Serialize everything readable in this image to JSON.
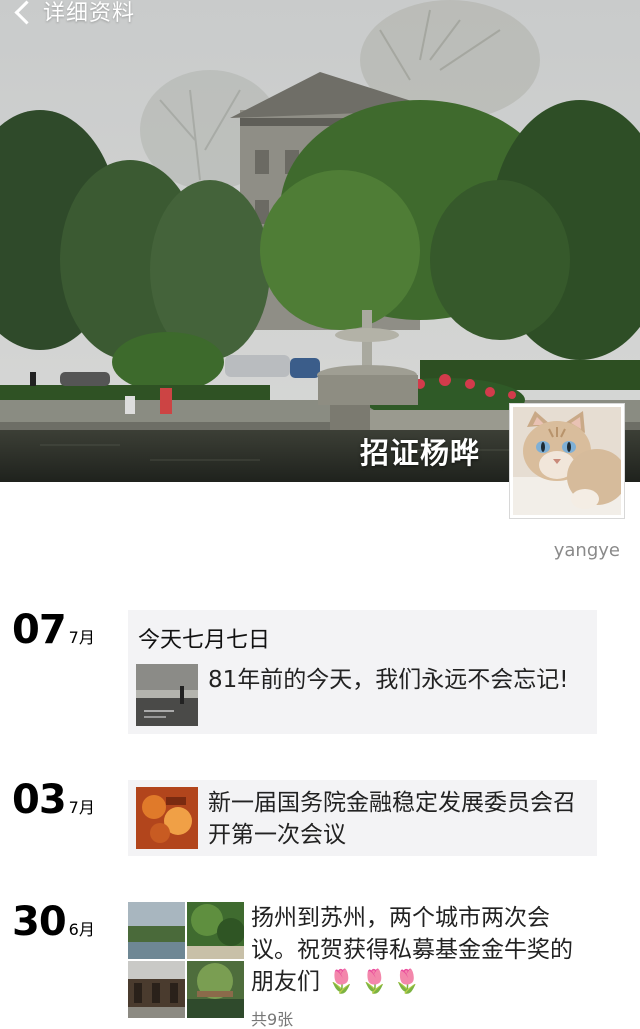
{
  "nav": {
    "back_label": "详细资料",
    "back_icon": "chevron-left-icon"
  },
  "profile": {
    "name": "招证杨晔",
    "signature": "yangye",
    "avatar_subject": "cat"
  },
  "timeline": [
    {
      "day": "07",
      "month": "7月",
      "title": "今天七月七日",
      "link_text": "81年前的今天，我们永远不会忘记!"
    },
    {
      "day": "03",
      "month": "7月",
      "link_text": "新一届国务院金融稳定发展委员会召开第一次会议"
    },
    {
      "day": "30",
      "month": "6月",
      "text": "扬州到苏州，两个城市两次会议。祝贺获得私募基金金牛奖的朋友们",
      "emoji": "🌷🌷🌷",
      "photo_count": "共9张"
    }
  ],
  "colors": {
    "card_bg": "#f3f3f5",
    "muted_text": "#8a8a8a",
    "accent_red": "#d23"
  }
}
